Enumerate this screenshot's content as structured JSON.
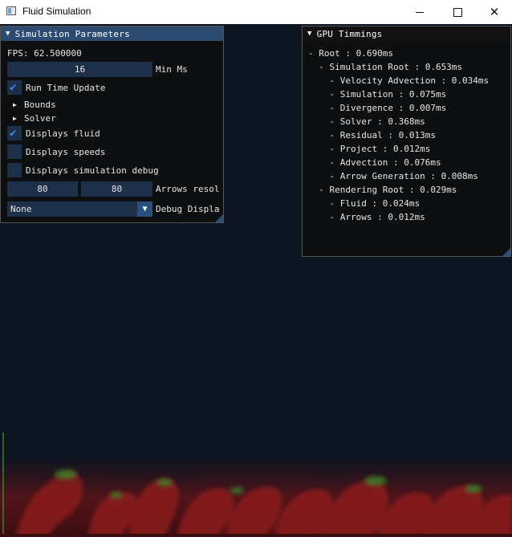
{
  "window": {
    "title": "Fluid Simulation",
    "minimize_icon": "minimize-icon",
    "maximize_icon": "maximize-icon",
    "close_icon": "close-icon"
  },
  "sim_panel": {
    "title": "Simulation Parameters",
    "fps": "FPS: 62.500000",
    "min_ms_value": "16",
    "min_ms_label": "Min Ms",
    "run_time_update": "Run Time Update",
    "run_time_update_checked": true,
    "bounds": "Bounds",
    "solver": "Solver",
    "displays_fluid": "Displays fluid",
    "displays_fluid_checked": true,
    "displays_speeds": "Displays speeds",
    "displays_speeds_checked": false,
    "displays_sim_debug": "Displays simulation debug",
    "displays_sim_debug_checked": false,
    "arrows_x": "80",
    "arrows_y": "80",
    "arrows_label": "Arrows resol",
    "debug_value": "None",
    "debug_label": "Debug Displa"
  },
  "gpu_panel": {
    "title": "GPU Timmings",
    "lines": [
      "- Root : 0.690ms",
      "  - Simulation Root : 0.653ms",
      "    - Velocity Advection : 0.034ms",
      "    - Simulation : 0.075ms",
      "    - Divergence : 0.007ms",
      "    - Solver : 0.368ms",
      "    - Residual : 0.013ms",
      "    - Project : 0.012ms",
      "    - Advection : 0.076ms",
      "    - Arrow Generation : 0.008ms",
      "  - Rendering Root : 0.029ms",
      "    - Fluid : 0.024ms",
      "    - Arrows : 0.012ms"
    ]
  },
  "colors": {
    "background": "#0b1420",
    "accent": "#2d4a70",
    "frame": "#1d2f49",
    "check": "#3d8cf0",
    "fluid_red": "#8c1a1e",
    "fluid_green": "#3d8a2c"
  }
}
